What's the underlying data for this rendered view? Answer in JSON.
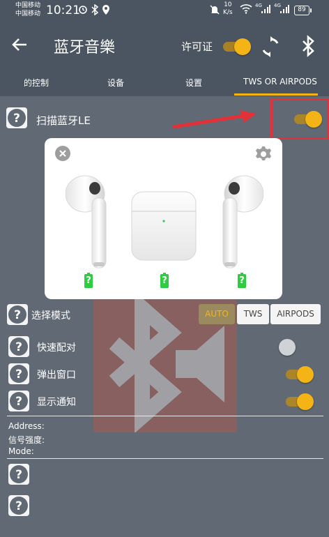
{
  "status_bar": {
    "carrier_1": "中国移动",
    "carrier_2": "中国移动",
    "time": "10:21",
    "net_speed": "10\nK/s",
    "signal_1": "4G",
    "signal_2": "4G",
    "battery": "89"
  },
  "appbar": {
    "title": "蓝牙音樂",
    "license_label": "许可证"
  },
  "tabs": [
    {
      "label": "的控制"
    },
    {
      "label": "设备"
    },
    {
      "label": "设置"
    },
    {
      "label": "TWS OR AIRPODS"
    }
  ],
  "active_tab": 3,
  "scan": {
    "label": "扫描蓝牙LE",
    "on": true
  },
  "mode": {
    "label": "选择模式",
    "options": [
      "AUTO",
      "TWS",
      "AIRPODS"
    ],
    "selected": "AUTO"
  },
  "rows": [
    {
      "label": "快速配对",
      "on": false
    },
    {
      "label": "弹出窗口",
      "on": true
    },
    {
      "label": "显示通知",
      "on": true
    }
  ],
  "info": {
    "address": "Address:",
    "signal": "信号强度:",
    "mode": "Mode:"
  },
  "popup": {
    "battery_left": "?",
    "battery_case": "?",
    "battery_right": "?"
  },
  "colors": {
    "accent": "#f5b416",
    "bar": "#4a5561",
    "background": "#616a74",
    "annotation": "#e03238",
    "battery_green": "#2ecc40"
  }
}
